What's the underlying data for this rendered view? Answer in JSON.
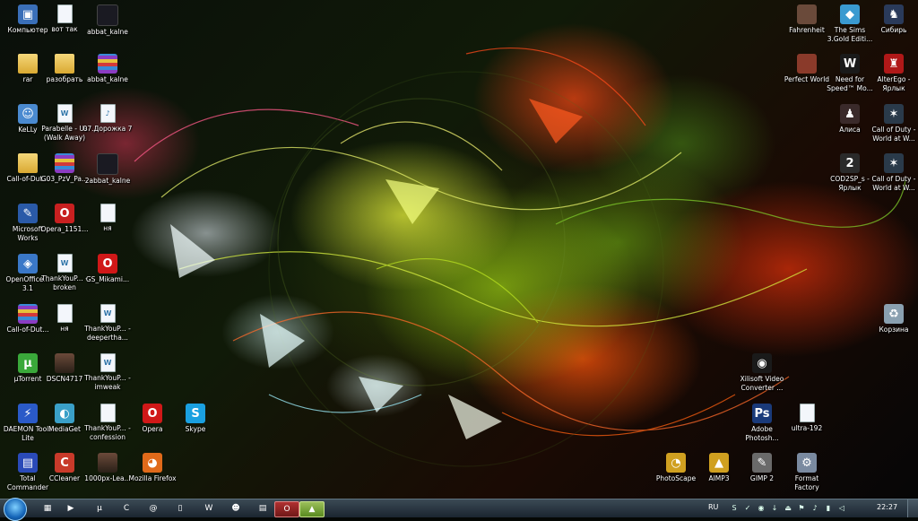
{
  "desktop_icons": [
    {
      "label": "Компьютер",
      "icon": "computer-icon",
      "glyph": "▣"
    },
    {
      "label": "вот так",
      "icon": "document-icon",
      "glyph": ""
    },
    {
      "label": "abbat_kalne",
      "icon": "dark-file-icon",
      "glyph": ""
    },
    {
      "label": "rar",
      "icon": "folder-icon",
      "glyph": ""
    },
    {
      "label": "разобрать",
      "icon": "folder-icon",
      "glyph": ""
    },
    {
      "label": "abbat_kalne",
      "icon": "winrar-icon",
      "glyph": ""
    },
    {
      "label": "KeLLy",
      "icon": "users-icon",
      "glyph": "☺"
    },
    {
      "label": "Parabelle - Us (Walk Away)",
      "icon": "word-document-icon",
      "glyph": "W"
    },
    {
      "label": "07.Дорожка 7",
      "icon": "wma-icon",
      "glyph": "♪"
    },
    {
      "label": "Call-of-Dut...",
      "icon": "folder-icon",
      "glyph": ""
    },
    {
      "label": "G03_PzV_Pa...",
      "icon": "winrar-icon",
      "glyph": ""
    },
    {
      "label": "2abbat_kalne",
      "icon": "dark-file-icon",
      "glyph": ""
    },
    {
      "label": "Microsoft Works",
      "icon": "works-icon",
      "glyph": "✎"
    },
    {
      "label": "Opera_1151...",
      "icon": "opera-setup-icon",
      "glyph": "O"
    },
    {
      "label": "ня",
      "icon": "document-icon",
      "glyph": ""
    },
    {
      "label": "OpenOffice... 3.1",
      "icon": "openoffice-icon",
      "glyph": "◈"
    },
    {
      "label": "ThankYouP... - broken",
      "icon": "word-document-icon",
      "glyph": "W"
    },
    {
      "label": "GS_Mikami...",
      "icon": "opera-icon",
      "glyph": "O"
    },
    {
      "label": "Call-of-Dut...",
      "icon": "winrar-icon",
      "glyph": ""
    },
    {
      "label": "ня",
      "icon": "document-icon",
      "glyph": ""
    },
    {
      "label": "ThankYouP... - deeperthа...",
      "icon": "word-document-icon",
      "glyph": "W"
    },
    {
      "label": "µTorrent",
      "icon": "utorrent-icon",
      "glyph": "µ"
    },
    {
      "label": "DSCN4717",
      "icon": "photo-icon",
      "glyph": ""
    },
    {
      "label": "ThankYouP... - imweak",
      "icon": "word-document-icon",
      "glyph": "W"
    },
    {
      "label": "DAEMON Tools Lite",
      "icon": "daemon-tools-icon",
      "glyph": "⚡"
    },
    {
      "label": "MediaGet",
      "icon": "mediaget-icon",
      "glyph": "◐"
    },
    {
      "label": "ThankYouP... - confession",
      "icon": "document-icon",
      "glyph": ""
    },
    {
      "label": "Opera",
      "icon": "opera-icon",
      "glyph": "O"
    },
    {
      "label": "Skype",
      "icon": "skype-icon",
      "glyph": "S"
    },
    {
      "label": "Total Commander",
      "icon": "total-commander-icon",
      "glyph": "▤"
    },
    {
      "label": "CCleaner",
      "icon": "ccleaner-icon",
      "glyph": "C"
    },
    {
      "label": "1000px-Lea...",
      "icon": "image-icon",
      "glyph": ""
    },
    {
      "label": "Mozilla Firefox",
      "icon": "firefox-icon",
      "glyph": "◕"
    },
    {
      "label": "Fahrenheit",
      "icon": "game-fahrenheit-icon",
      "glyph": ""
    },
    {
      "label": "The Sims 3.Gold Editi...",
      "icon": "sims-icon",
      "glyph": "◆"
    },
    {
      "label": "Сибирь",
      "icon": "game-syberia-icon",
      "glyph": "♞"
    },
    {
      "label": "Perfect World",
      "icon": "game-perfect-world-icon",
      "glyph": ""
    },
    {
      "label": "Need for Speed™ Mo...",
      "icon": "game-nfs-icon",
      "glyph": "W"
    },
    {
      "label": "AlterEgo - Ярлык",
      "icon": "game-alterego-icon",
      "glyph": "♜"
    },
    {
      "label": "Алиса",
      "icon": "game-alice-icon",
      "glyph": "♟"
    },
    {
      "label": "Call of Duty - World at W...",
      "icon": "game-cod-icon",
      "glyph": "✶"
    },
    {
      "label": "COD2SP_s - Ярлык",
      "icon": "game-cod2-icon",
      "glyph": "2"
    },
    {
      "label": "Call of Duty - World at W...",
      "icon": "game-cod-icon",
      "glyph": "✶"
    },
    {
      "label": "Корзина",
      "icon": "recycle-bin-icon",
      "glyph": "♻"
    },
    {
      "label": "Xilisoft Video Converter ...",
      "icon": "xilisoft-icon",
      "glyph": "◉"
    },
    {
      "label": "Adobe Photosh...",
      "icon": "photoshop-icon",
      "glyph": "Ps"
    },
    {
      "label": "ultra-192",
      "icon": "document-icon",
      "glyph": ""
    },
    {
      "label": "PhotoScape",
      "icon": "photoscape-icon",
      "glyph": "◔"
    },
    {
      "label": "AIMP3",
      "icon": "aimp-icon",
      "glyph": "▲"
    },
    {
      "label": "GIMP 2",
      "icon": "gimp-icon",
      "glyph": "✎"
    },
    {
      "label": "Format Factory",
      "icon": "format-factory-icon",
      "glyph": "⚙"
    }
  ],
  "taskbar": {
    "start_label": "Start",
    "pinned": [
      {
        "name": "explorer-icon",
        "glyph": "▦"
      },
      {
        "name": "media-player-icon",
        "glyph": "▶"
      },
      {
        "name": "utorrent-icon",
        "glyph": "µ"
      },
      {
        "name": "ccleaner-icon",
        "glyph": "C"
      },
      {
        "name": "mail-agent-icon",
        "glyph": "@"
      },
      {
        "name": "document-icon",
        "glyph": "▯"
      },
      {
        "name": "word-icon",
        "glyph": "W"
      },
      {
        "name": "smiley-icon",
        "glyph": "☻"
      },
      {
        "name": "notepad-icon",
        "glyph": "▤"
      },
      {
        "name": "opera-icon",
        "glyph": "O"
      },
      {
        "name": "aimp-icon",
        "glyph": "▲"
      }
    ],
    "language": "RU",
    "tray_icons": [
      "skype-icon",
      "antivirus-icon",
      "network-icon",
      "download-icon",
      "safely-remove-icon",
      "flag-icon",
      "volume-icon",
      "battery-icon",
      "speaker-icon"
    ],
    "clock": "22:27"
  }
}
